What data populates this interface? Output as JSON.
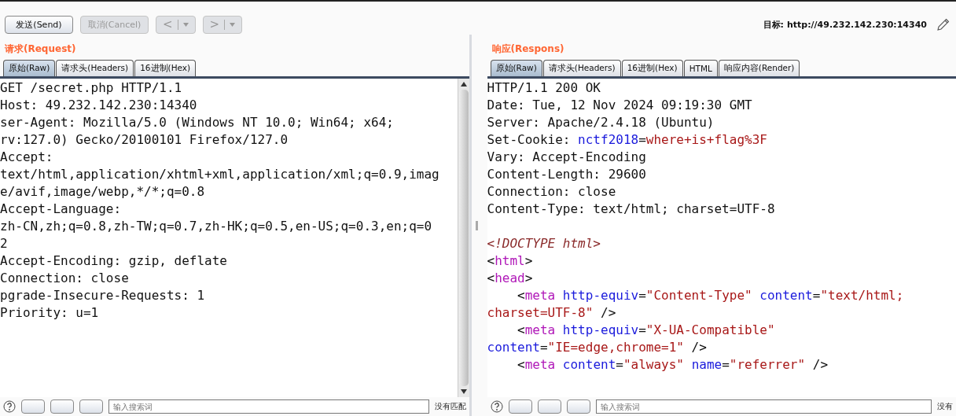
{
  "toolbar": {
    "buttons": [
      {
        "label": "发送(Send)",
        "kind": "text",
        "disabled": false
      },
      {
        "label": "取消(Cancel)",
        "kind": "text",
        "disabled": true
      },
      {
        "label": "<",
        "kind": "nav",
        "disabled": true
      },
      {
        "label": ">",
        "kind": "nav",
        "disabled": true
      }
    ],
    "target_label": "目标:",
    "target_url": "http://49.232.142.230:14340"
  },
  "panes": [
    {
      "title": "请求(Request)",
      "scrollbar": true,
      "tabs": [
        {
          "label": "原始(Raw)",
          "selected": true
        },
        {
          "label": "请求头(Headers)",
          "selected": false
        },
        {
          "label": "16进制(Hex)",
          "selected": false
        }
      ],
      "lines": [
        [
          {
            "kind": "plain",
            "text": "GET /secret.php HTTP/1.1"
          }
        ],
        [
          {
            "kind": "plain",
            "text": "Host: 49.232.142.230:14340"
          }
        ],
        [
          {
            "kind": "plain",
            "text": "ser-Agent: Mozilla/5.0 (Windows NT 10.0; Win64; x64;"
          }
        ],
        [
          {
            "kind": "plain",
            "text": "rv:127.0) Gecko/20100101 Firefox/127.0"
          }
        ],
        [
          {
            "kind": "plain",
            "text": "Accept:"
          }
        ],
        [
          {
            "kind": "plain",
            "text": "text/html,application/xhtml+xml,application/xml;q=0.9,imag"
          }
        ],
        [
          {
            "kind": "plain",
            "text": "e/avif,image/webp,*/*;q=0.8"
          }
        ],
        [
          {
            "kind": "plain",
            "text": "Accept-Language:"
          }
        ],
        [
          {
            "kind": "plain",
            "text": "zh-CN,zh;q=0.8,zh-TW;q=0.7,zh-HK;q=0.5,en-US;q=0.3,en;q=0"
          }
        ],
        [
          {
            "kind": "plain",
            "text": "2"
          }
        ],
        [
          {
            "kind": "plain",
            "text": "Accept-Encoding: gzip, deflate"
          }
        ],
        [
          {
            "kind": "plain",
            "text": "Connection: close"
          }
        ],
        [
          {
            "kind": "plain",
            "text": "pgrade-Insecure-Requests: 1"
          }
        ],
        [
          {
            "kind": "plain",
            "text": "Priority: u=1"
          }
        ]
      ],
      "search_placeholder": "输入搜索词",
      "match_label": "没有匹配"
    },
    {
      "title": "响应(Respons)",
      "scrollbar": false,
      "tabs": [
        {
          "label": "原始(Raw)",
          "selected": true
        },
        {
          "label": "请求头(Headers)",
          "selected": false
        },
        {
          "label": "16进制(Hex)",
          "selected": false
        },
        {
          "label": "HTML",
          "selected": false
        },
        {
          "label": "响应内容(Render)",
          "selected": false
        }
      ],
      "lines": [
        [
          {
            "kind": "plain",
            "text": "HTTP/1.1 200 OK"
          }
        ],
        [
          {
            "kind": "plain",
            "text": "Date: Tue, 12 Nov 2024 09:19:30 GMT"
          }
        ],
        [
          {
            "kind": "plain",
            "text": "Server: Apache/2.4.18 (Ubuntu)"
          }
        ],
        [
          {
            "kind": "plain",
            "text": "Set-Cookie: "
          },
          {
            "kind": "key",
            "text": "nctf2018"
          },
          {
            "kind": "plain",
            "text": "="
          },
          {
            "kind": "value",
            "text": "where+is+flag%3F"
          }
        ],
        [
          {
            "kind": "plain",
            "text": "Vary: Accept-Encoding"
          }
        ],
        [
          {
            "kind": "plain",
            "text": "Content-Length: 29600"
          }
        ],
        [
          {
            "kind": "plain",
            "text": "Connection: close"
          }
        ],
        [
          {
            "kind": "plain",
            "text": "Content-Type: text/html; charset=UTF-8"
          }
        ],
        [
          {
            "kind": "blank"
          }
        ],
        [
          {
            "kind": "doctype",
            "text": "<!DOCTYPE html>"
          }
        ],
        [
          {
            "kind": "plain",
            "text": "<"
          },
          {
            "kind": "tag",
            "text": "html"
          },
          {
            "kind": "plain",
            "text": ">"
          }
        ],
        [
          {
            "kind": "plain",
            "text": "<"
          },
          {
            "kind": "tag",
            "text": "head"
          },
          {
            "kind": "plain",
            "text": ">"
          }
        ],
        [
          {
            "kind": "plain",
            "text": "    <"
          },
          {
            "kind": "tag",
            "text": "meta "
          },
          {
            "kind": "key",
            "text": "http-equiv"
          },
          {
            "kind": "plain",
            "text": "="
          },
          {
            "kind": "value",
            "text": "\"Content-Type\" "
          },
          {
            "kind": "key",
            "text": "content"
          },
          {
            "kind": "plain",
            "text": "="
          },
          {
            "kind": "value",
            "text": "\"text/html;"
          }
        ],
        [
          {
            "kind": "value",
            "text": "charset=UTF-8\""
          },
          {
            "kind": "plain",
            "text": " />"
          }
        ],
        [
          {
            "kind": "plain",
            "text": "    <"
          },
          {
            "kind": "tag",
            "text": "meta "
          },
          {
            "kind": "key",
            "text": "http-equiv"
          },
          {
            "kind": "plain",
            "text": "="
          },
          {
            "kind": "value",
            "text": "\"X-UA-Compatible\""
          }
        ],
        [
          {
            "kind": "key",
            "text": "content"
          },
          {
            "kind": "plain",
            "text": "="
          },
          {
            "kind": "value",
            "text": "\"IE=edge,chrome=1\""
          },
          {
            "kind": "plain",
            "text": " />"
          }
        ],
        [
          {
            "kind": "plain",
            "text": "    <"
          },
          {
            "kind": "tag",
            "text": "meta "
          },
          {
            "kind": "key",
            "text": "content"
          },
          {
            "kind": "plain",
            "text": "="
          },
          {
            "kind": "value",
            "text": "\"always\" "
          },
          {
            "kind": "key",
            "text": "name"
          },
          {
            "kind": "plain",
            "text": "="
          },
          {
            "kind": "value",
            "text": "\"referrer\""
          },
          {
            "kind": "plain",
            "text": " />"
          }
        ]
      ],
      "search_placeholder": "输入搜索词",
      "match_label": "没有"
    }
  ]
}
